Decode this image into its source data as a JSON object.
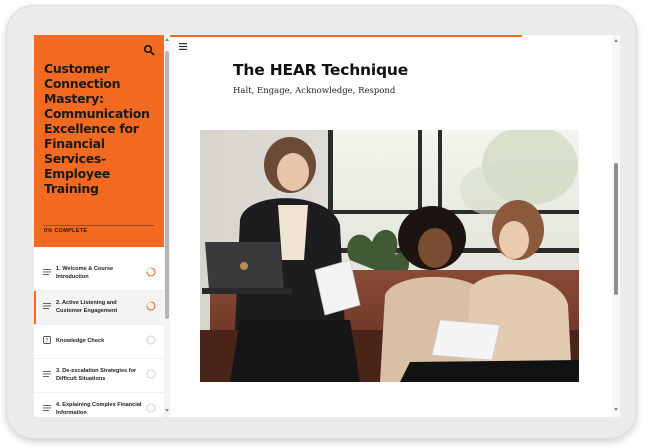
{
  "course": {
    "title": "Customer Connection Mastery: Communication Excellence for Financial Services-Employee Training",
    "progress_text": "0% COMPLETE"
  },
  "icons": {
    "search": "search-icon",
    "menu": "hamburger-menu-icon",
    "lesson": "lines-icon",
    "quiz": "quiz-icon"
  },
  "lessons": [
    {
      "label": "1. Welcome & Course Introduction",
      "status": "in-progress"
    },
    {
      "label": "2. Active Listening and Customer Engagement",
      "status": "in-progress"
    },
    {
      "label": "Knowledge Check",
      "status": "not-started"
    },
    {
      "label": "3. De-escalation Strategies for Difficult Situations",
      "status": "not-started"
    },
    {
      "label": "4. Explaining Complex Financial Information",
      "status": "not-started"
    }
  ],
  "main": {
    "heading": "The HEAR Technique",
    "subtitle": "Halt, Engage, Acknowledge, Respond"
  },
  "colors": {
    "accent": "#f26a21",
    "text": "#111111"
  }
}
